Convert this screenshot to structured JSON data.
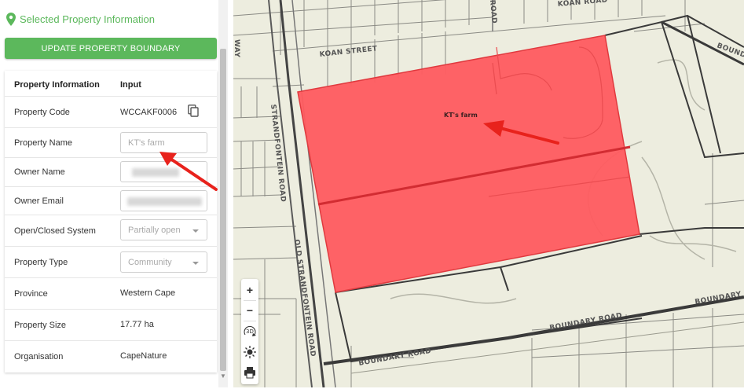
{
  "panel": {
    "section_title": "Selected Property Information",
    "update_button": "UPDATE PROPERTY BOUNDARY",
    "table": {
      "header": {
        "key": "Property Information",
        "value": "Input"
      },
      "property_code": {
        "label": "Property Code",
        "value": "WCCAKF0006"
      },
      "property_name": {
        "label": "Property Name",
        "placeholder": "KT's farm"
      },
      "owner_name": {
        "label": "Owner Name"
      },
      "owner_email": {
        "label": "Owner Email"
      },
      "system": {
        "label": "Open/Closed System",
        "selected": "Partially open"
      },
      "property_type": {
        "label": "Property Type",
        "selected": "Community"
      },
      "province": {
        "label": "Province",
        "value": "Western Cape"
      },
      "property_size": {
        "label": "Property Size",
        "value": "17.77 ha"
      },
      "organisation": {
        "label": "Organisation",
        "value": "CapeNature"
      }
    }
  },
  "map": {
    "parcel_label": "KT's farm",
    "roads": {
      "koan_street": "KOAN STREET",
      "koan_road": "KOAN ROAD",
      "road_top": "ROAD",
      "boundary_top_right": "BOUND",
      "strandfontein": "STRANDFONTEIN ROAD",
      "old_strandfontein": "OLD STRANDFONTEIN ROAD",
      "boundary_road_1": "BOUNDARY ROAD",
      "boundary_road_2": "BOUNDARY ROAD",
      "boundary_road_3": "BOUNDARY ROAD",
      "way": "WAY"
    },
    "controls": {
      "zoom_in": "+",
      "zoom_out": "−",
      "three_d": "3D"
    },
    "colors": {
      "parcel_fill": "#ff5b5f",
      "parcel_stroke": "#e03a3f",
      "annotation_arrow": "#e8221c",
      "map_bg": "#ededdf"
    }
  }
}
